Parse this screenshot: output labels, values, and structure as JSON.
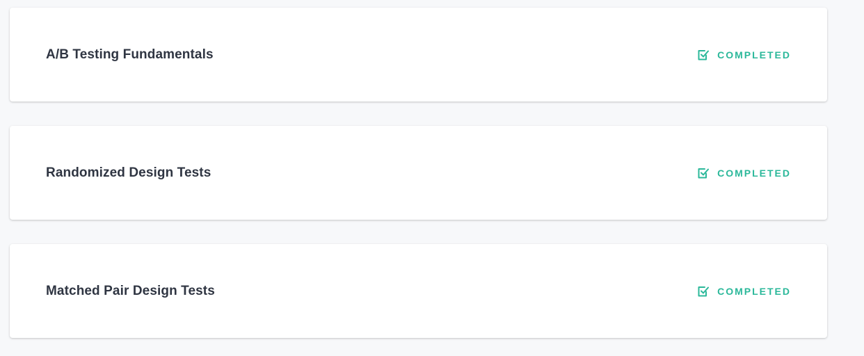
{
  "modules": [
    {
      "title": "A/B Testing Fundamentals",
      "status": "COMPLETED",
      "status_icon": "checkbox-checked-icon"
    },
    {
      "title": "Randomized Design Tests",
      "status": "COMPLETED",
      "status_icon": "checkbox-checked-icon"
    },
    {
      "title": "Matched Pair Design Tests",
      "status": "COMPLETED",
      "status_icon": "checkbox-checked-icon"
    }
  ],
  "colors": {
    "page_background": "#f7f8fa",
    "card_background": "#ffffff",
    "title_text": "#2f3542",
    "status_green": "#2bb89a"
  }
}
